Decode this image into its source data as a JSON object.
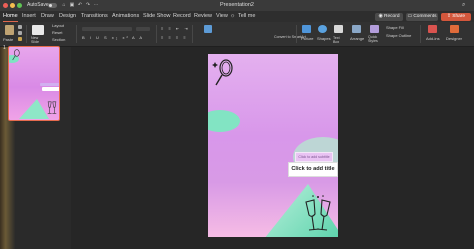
{
  "window": {
    "title": "Presentation2",
    "autosave_label": "AutoSave"
  },
  "tabs": [
    "Home",
    "Insert",
    "Draw",
    "Design",
    "Transitions",
    "Animations",
    "Slide Show",
    "Record",
    "Review",
    "View",
    "Tell me"
  ],
  "header_buttons": {
    "record": "Record",
    "comments": "Comments",
    "share": "Share"
  },
  "ribbon": {
    "paste": "Paste",
    "new_slide": "New\nSlide",
    "layout": "Layout",
    "reset": "Reset",
    "section": "Section",
    "convert_smartart": "Convert to SmartArt",
    "picture": "Picture",
    "shapes": "Shapes",
    "text_box": "Text Box",
    "arrange": "Arrange",
    "quick_styles": "Quick Styles",
    "shape_fill": "Shape Fill",
    "shape_outline": "Shape Outline",
    "addins": "Add-ins",
    "designer": "Designer"
  },
  "thumbnails": [
    {
      "number": "1"
    }
  ],
  "slide": {
    "subtitle_placeholder": "Click to add subtitle",
    "title_placeholder": "Click to add title"
  },
  "colors": {
    "accent": "#e0674d",
    "share": "#d3573c"
  }
}
